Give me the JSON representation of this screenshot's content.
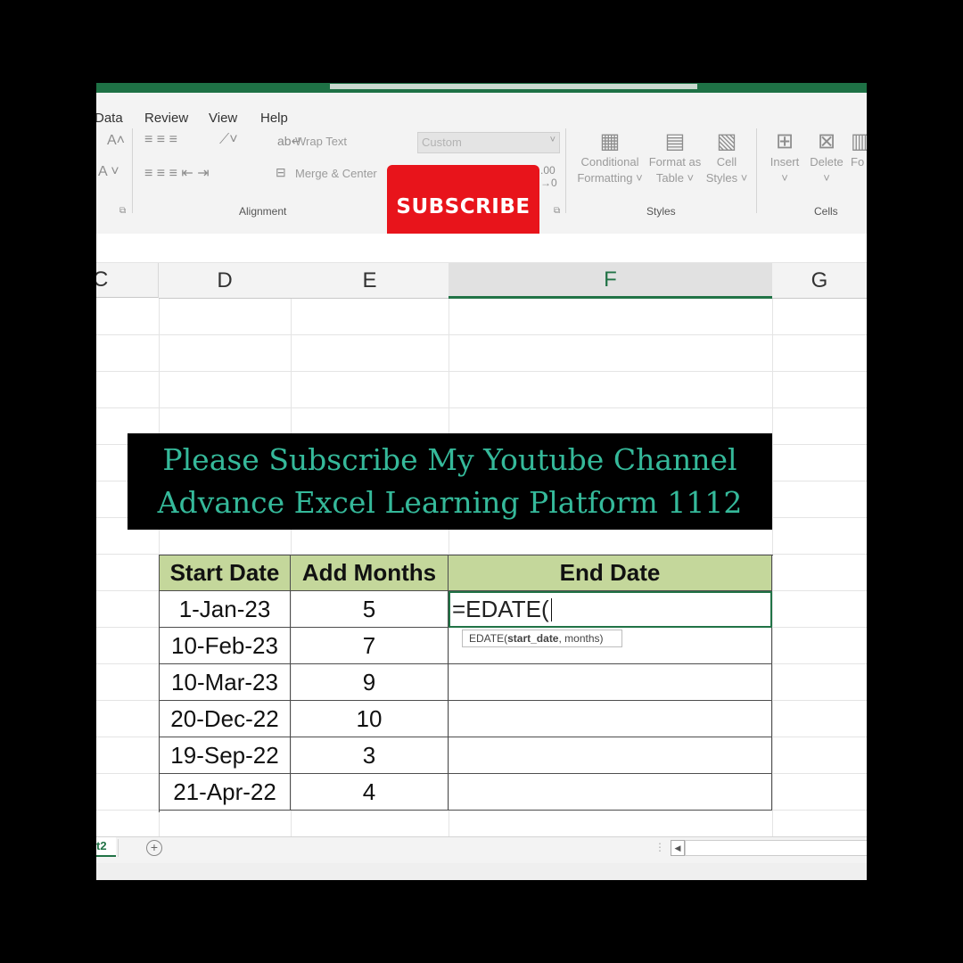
{
  "menu": [
    "Data",
    "Review",
    "View",
    "Help"
  ],
  "ribbon": {
    "wrap_text": "Wrap Text",
    "merge_center": "Merge & Center",
    "number_format": "Custom",
    "conditional_formatting": [
      "Conditional",
      "Formatting"
    ],
    "format_as_table": [
      "Format as",
      "Table"
    ],
    "cell_styles": [
      "Cell",
      "Styles"
    ],
    "insert": "Insert",
    "delete": "Delete",
    "format_partial": "Fo",
    "groups": {
      "alignment": "Alignment",
      "styles": "Styles",
      "cells": "Cells"
    }
  },
  "subscribe_label": "SUBSCRIBE",
  "columns": [
    "C",
    "D",
    "E",
    "F",
    "G"
  ],
  "banner": {
    "line1": "Please Subscribe My Youtube Channel",
    "line2": "Advance Excel Learning Platform 1112"
  },
  "table": {
    "headers": [
      "Start Date",
      "Add Months",
      "End Date"
    ],
    "rows": [
      [
        "1-Jan-23",
        "5",
        "=EDATE("
      ],
      [
        "10-Feb-23",
        "7",
        ""
      ],
      [
        "10-Mar-23",
        "9",
        ""
      ],
      [
        "20-Dec-22",
        "10",
        ""
      ],
      [
        "19-Sep-22",
        "3",
        ""
      ],
      [
        "21-Apr-22",
        "4",
        ""
      ]
    ]
  },
  "tooltip": {
    "func": "EDATE(",
    "arg1": "start_date",
    "rest": ", months)"
  },
  "sheet_tab": "t2",
  "icons": [
    "font-grow-icon",
    "align-icon",
    "orientation-icon",
    "wrap-text-icon",
    "merge-icon",
    "conditional-formatting-icon",
    "format-table-icon",
    "cell-styles-icon",
    "insert-icon",
    "delete-icon",
    "add-sheet-icon",
    "scroll-left-icon"
  ]
}
